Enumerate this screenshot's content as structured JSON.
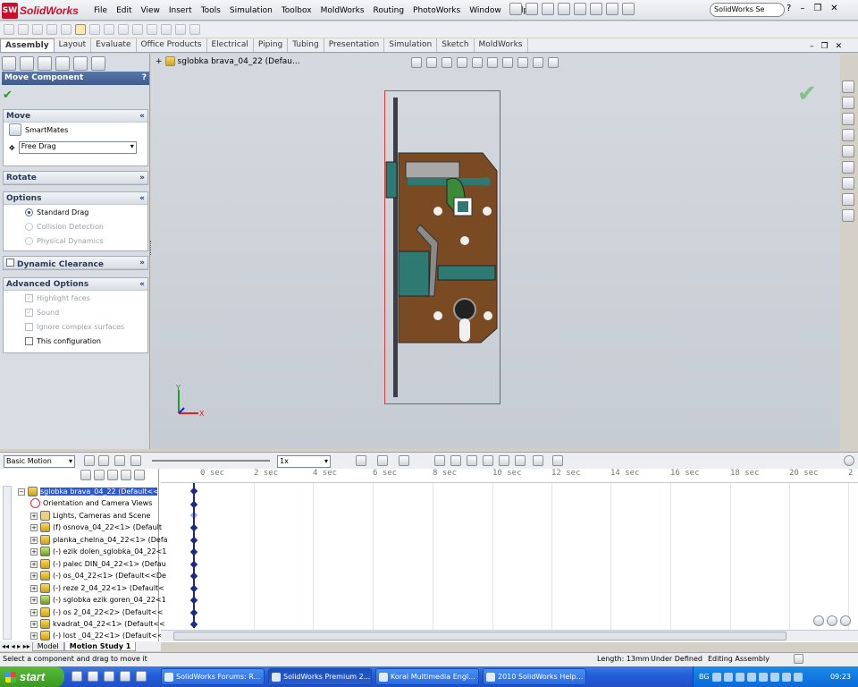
{
  "app": {
    "name": "SolidWorks",
    "logo_text": "SW"
  },
  "menu": [
    "File",
    "Edit",
    "View",
    "Insert",
    "Tools",
    "Simulation",
    "Toolbox",
    "MoldWorks",
    "Routing",
    "PhotoWorks",
    "Window",
    "Help"
  ],
  "search": {
    "placeholder": "SolidWorks Se"
  },
  "window_buttons": {
    "help": "?",
    "minimize": "–",
    "restore": "❐",
    "close": "✕"
  },
  "ribbon_tabs": [
    {
      "label": "Assembly",
      "active": true
    },
    {
      "label": "Layout"
    },
    {
      "label": "Evaluate"
    },
    {
      "label": "Office Products"
    },
    {
      "label": "Electrical"
    },
    {
      "label": "Piping"
    },
    {
      "label": "Tubing"
    },
    {
      "label": "Presentation"
    },
    {
      "label": "Simulation"
    },
    {
      "label": "Sketch"
    },
    {
      "label": "MoldWorks"
    }
  ],
  "property_manager": {
    "title": "Move Component",
    "help": "?",
    "move": {
      "header": "Move",
      "smartmates": "SmartMates",
      "drag_mode": "Free Drag"
    },
    "rotate": {
      "header": "Rotate"
    },
    "options": {
      "header": "Options",
      "standard_drag": "Standard Drag",
      "collision_detection": "Collision Detection",
      "physical_dynamics": "Physical Dynamics"
    },
    "dynamic_clearance": {
      "header": "Dynamic Clearance"
    },
    "advanced": {
      "header": "Advanced Options",
      "highlight_faces": "Highlight faces",
      "sound": "Sound",
      "ignore_complex": "Ignore complex surfaces",
      "this_configuration": "This configuration"
    }
  },
  "document": {
    "name": "sglobka brava_04_22  (Defau..."
  },
  "triad": {
    "y": "Y",
    "x": "X"
  },
  "motion": {
    "study_type": "Basic Motion",
    "speed": "1x"
  },
  "timeline": {
    "ticks": [
      "0 sec",
      "2 sec",
      "4 sec",
      "6 sec",
      "8 sec",
      "10 sec",
      "12 sec",
      "14 sec",
      "16 sec",
      "18 sec",
      "20 sec",
      "2"
    ]
  },
  "tree": [
    {
      "label": "sglobka brava_04_22  (Default<<D",
      "type": "root"
    },
    {
      "label": "Orientation and Camera Views",
      "type": "or"
    },
    {
      "label": "Lights, Cameras and Scene",
      "type": "fo"
    },
    {
      "label": "(f) osnova_04_22<1> (Default",
      "type": "part"
    },
    {
      "label": "planka_chelna_04_22<1> (Defa",
      "type": "part"
    },
    {
      "label": "(-) ezik dolen_sglobka_04_22<1",
      "type": "gr"
    },
    {
      "label": "(-) palec DIN_04_22<1> (Defau",
      "type": "part"
    },
    {
      "label": "(-) os_04_22<1> (Default<<De",
      "type": "part"
    },
    {
      "label": "(-) reze 2_04_22<1> (Default<",
      "type": "part"
    },
    {
      "label": "(-) sglobka ezik goren_04_22<1",
      "type": "gr"
    },
    {
      "label": "(-) os 2_04_22<2> (Default<<",
      "type": "part"
    },
    {
      "label": "kvadrat_04_22<1> (Default<<",
      "type": "part"
    },
    {
      "label": "(-) lost _04_22<1> (Default<<",
      "type": "part"
    }
  ],
  "bottom_tabs": [
    {
      "label": "Model"
    },
    {
      "label": "Motion Study 1",
      "active": true
    }
  ],
  "status": {
    "left": "Select a component and drag to move it",
    "length": "Length: 13mm",
    "defined": "Under Defined",
    "mode": "Editing Assembly"
  },
  "taskbar": {
    "start": "start",
    "buttons": [
      "SolidWorks Forums: R...",
      "SolidWorks Premium 2...",
      "Koral Multimedia Engl...",
      "2010 SolidWorks Help..."
    ],
    "lang": "BG",
    "clock": "09:23"
  }
}
